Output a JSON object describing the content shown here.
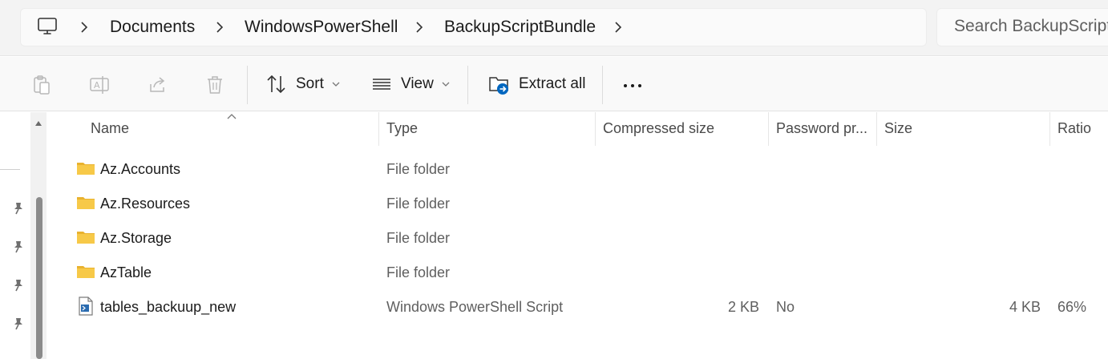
{
  "address_bar": {
    "crumbs": [
      "Documents",
      "WindowsPowerShell",
      "BackupScriptBundle"
    ]
  },
  "search": {
    "placeholder": "Search BackupScriptBundle"
  },
  "toolbar": {
    "sort_label": "Sort",
    "view_label": "View",
    "extract_label": "Extract all"
  },
  "columns": {
    "name": "Name",
    "type": "Type",
    "compressed": "Compressed size",
    "password": "Password pr...",
    "size": "Size",
    "ratio": "Ratio"
  },
  "files": [
    {
      "name": "Az.Accounts",
      "type": "File folder",
      "icon": "folder-icon",
      "compressed": "",
      "password": "",
      "size": "",
      "ratio": ""
    },
    {
      "name": "Az.Resources",
      "type": "File folder",
      "icon": "folder-icon",
      "compressed": "",
      "password": "",
      "size": "",
      "ratio": ""
    },
    {
      "name": "Az.Storage",
      "type": "File folder",
      "icon": "folder-icon",
      "compressed": "",
      "password": "",
      "size": "",
      "ratio": ""
    },
    {
      "name": "AzTable",
      "type": "File folder",
      "icon": "folder-icon",
      "compressed": "",
      "password": "",
      "size": "",
      "ratio": ""
    },
    {
      "name": "tables_backuup_new",
      "type": "Windows PowerShell Script",
      "icon": "powershell-script-icon",
      "compressed": "2 KB",
      "password": "No",
      "size": "4 KB",
      "ratio": "66%"
    }
  ],
  "colors": {
    "folder": "#f7c948",
    "accent": "#0067c0",
    "disabled_icon": "#b8b8b8"
  }
}
